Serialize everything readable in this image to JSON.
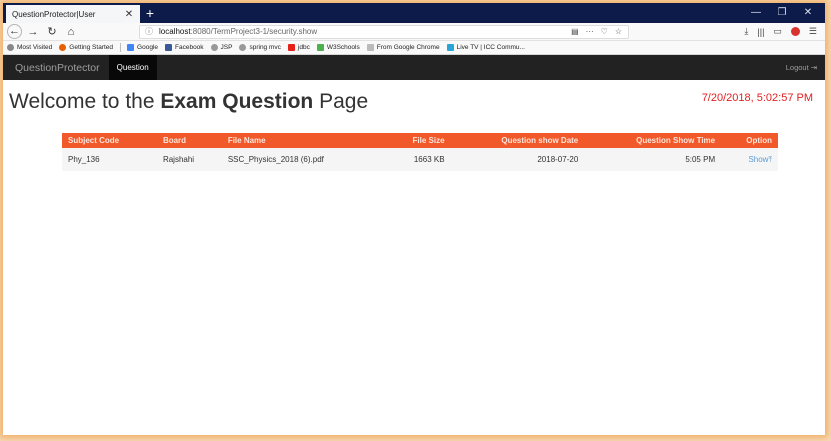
{
  "browser": {
    "tab_title": "QuestionProtector|User",
    "url_host": "localhost",
    "url_rest": ":8080/TermProject3-1/security.show",
    "bookmarks": [
      "Most Visited",
      "Getting Started",
      "Google",
      "Facebook",
      "JSP",
      "spring mvc",
      "jdbc",
      "W3Schools",
      "From Google Chrome",
      "Live TV | ICC Commu..."
    ]
  },
  "app": {
    "brand": "QuestionProtector",
    "menu_question": "Question",
    "logout": "Logout"
  },
  "page": {
    "welcome_pre": "Welcome to the ",
    "welcome_bold": "Exam Question",
    "welcome_post": " Page",
    "clock": "7/20/2018, 5:02:57 PM"
  },
  "table": {
    "headers": [
      "Subject Code",
      "Board",
      "File Name",
      "File Size",
      "Question show Date",
      "Question Show Time",
      "Option"
    ],
    "rows": [
      {
        "subject_code": "Phy_136",
        "board": "Rajshahi",
        "file_name": "SSC_Physics_2018 (6).pdf",
        "file_size": "1663 KB",
        "show_date": "2018-07-20",
        "show_time": "5:05 PM",
        "option": "Show"
      }
    ]
  },
  "colors": {
    "table_header": "#f2592a",
    "clock": "#e01f1f",
    "app_navbar": "#222222",
    "titlebar": "#0c1b4a"
  }
}
